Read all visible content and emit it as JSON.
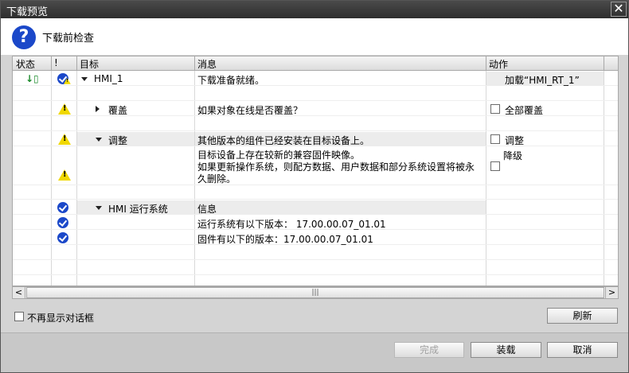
{
  "window": {
    "title": "下载预览",
    "close_glyph": "✕"
  },
  "header": {
    "text": "下载前检查",
    "icon": "question-icon"
  },
  "columns": {
    "status": "状态",
    "alert": "!",
    "target": "目标",
    "message": "消息",
    "action": "动作"
  },
  "rows": [
    {
      "target": "HMI_1",
      "message": "下载准备就绪。",
      "action": "加载“HMI_RT_1”"
    },
    {
      "target": "覆盖",
      "message": "如果对象在线是否覆盖？",
      "action": "全部覆盖"
    },
    {
      "target": "调整",
      "message": "其他版本的组件已经安装在目标设备上。",
      "action": "调整"
    },
    {
      "message_lines": [
        "目标设备上存在较新的兼容固件映像。",
        "如果更新操作系统，则配方数据、用户数据和部分系统设置将被永",
        "久删除。"
      ],
      "action": "降级"
    },
    {
      "target": "HMI 运行系统",
      "message": "信息"
    },
    {
      "message": "运行系统有以下版本： 17.00.00.07_01.01"
    },
    {
      "message": "固件有以下的版本：17.00.00.07_01.01"
    }
  ],
  "scrollbar": {
    "left": "<",
    "right": ">",
    "grip": "|||"
  },
  "dont_show": {
    "label": "不再显示对话框"
  },
  "buttons": {
    "refresh": "刷新",
    "finish": "完成",
    "load": "装载",
    "cancel": "取消"
  }
}
